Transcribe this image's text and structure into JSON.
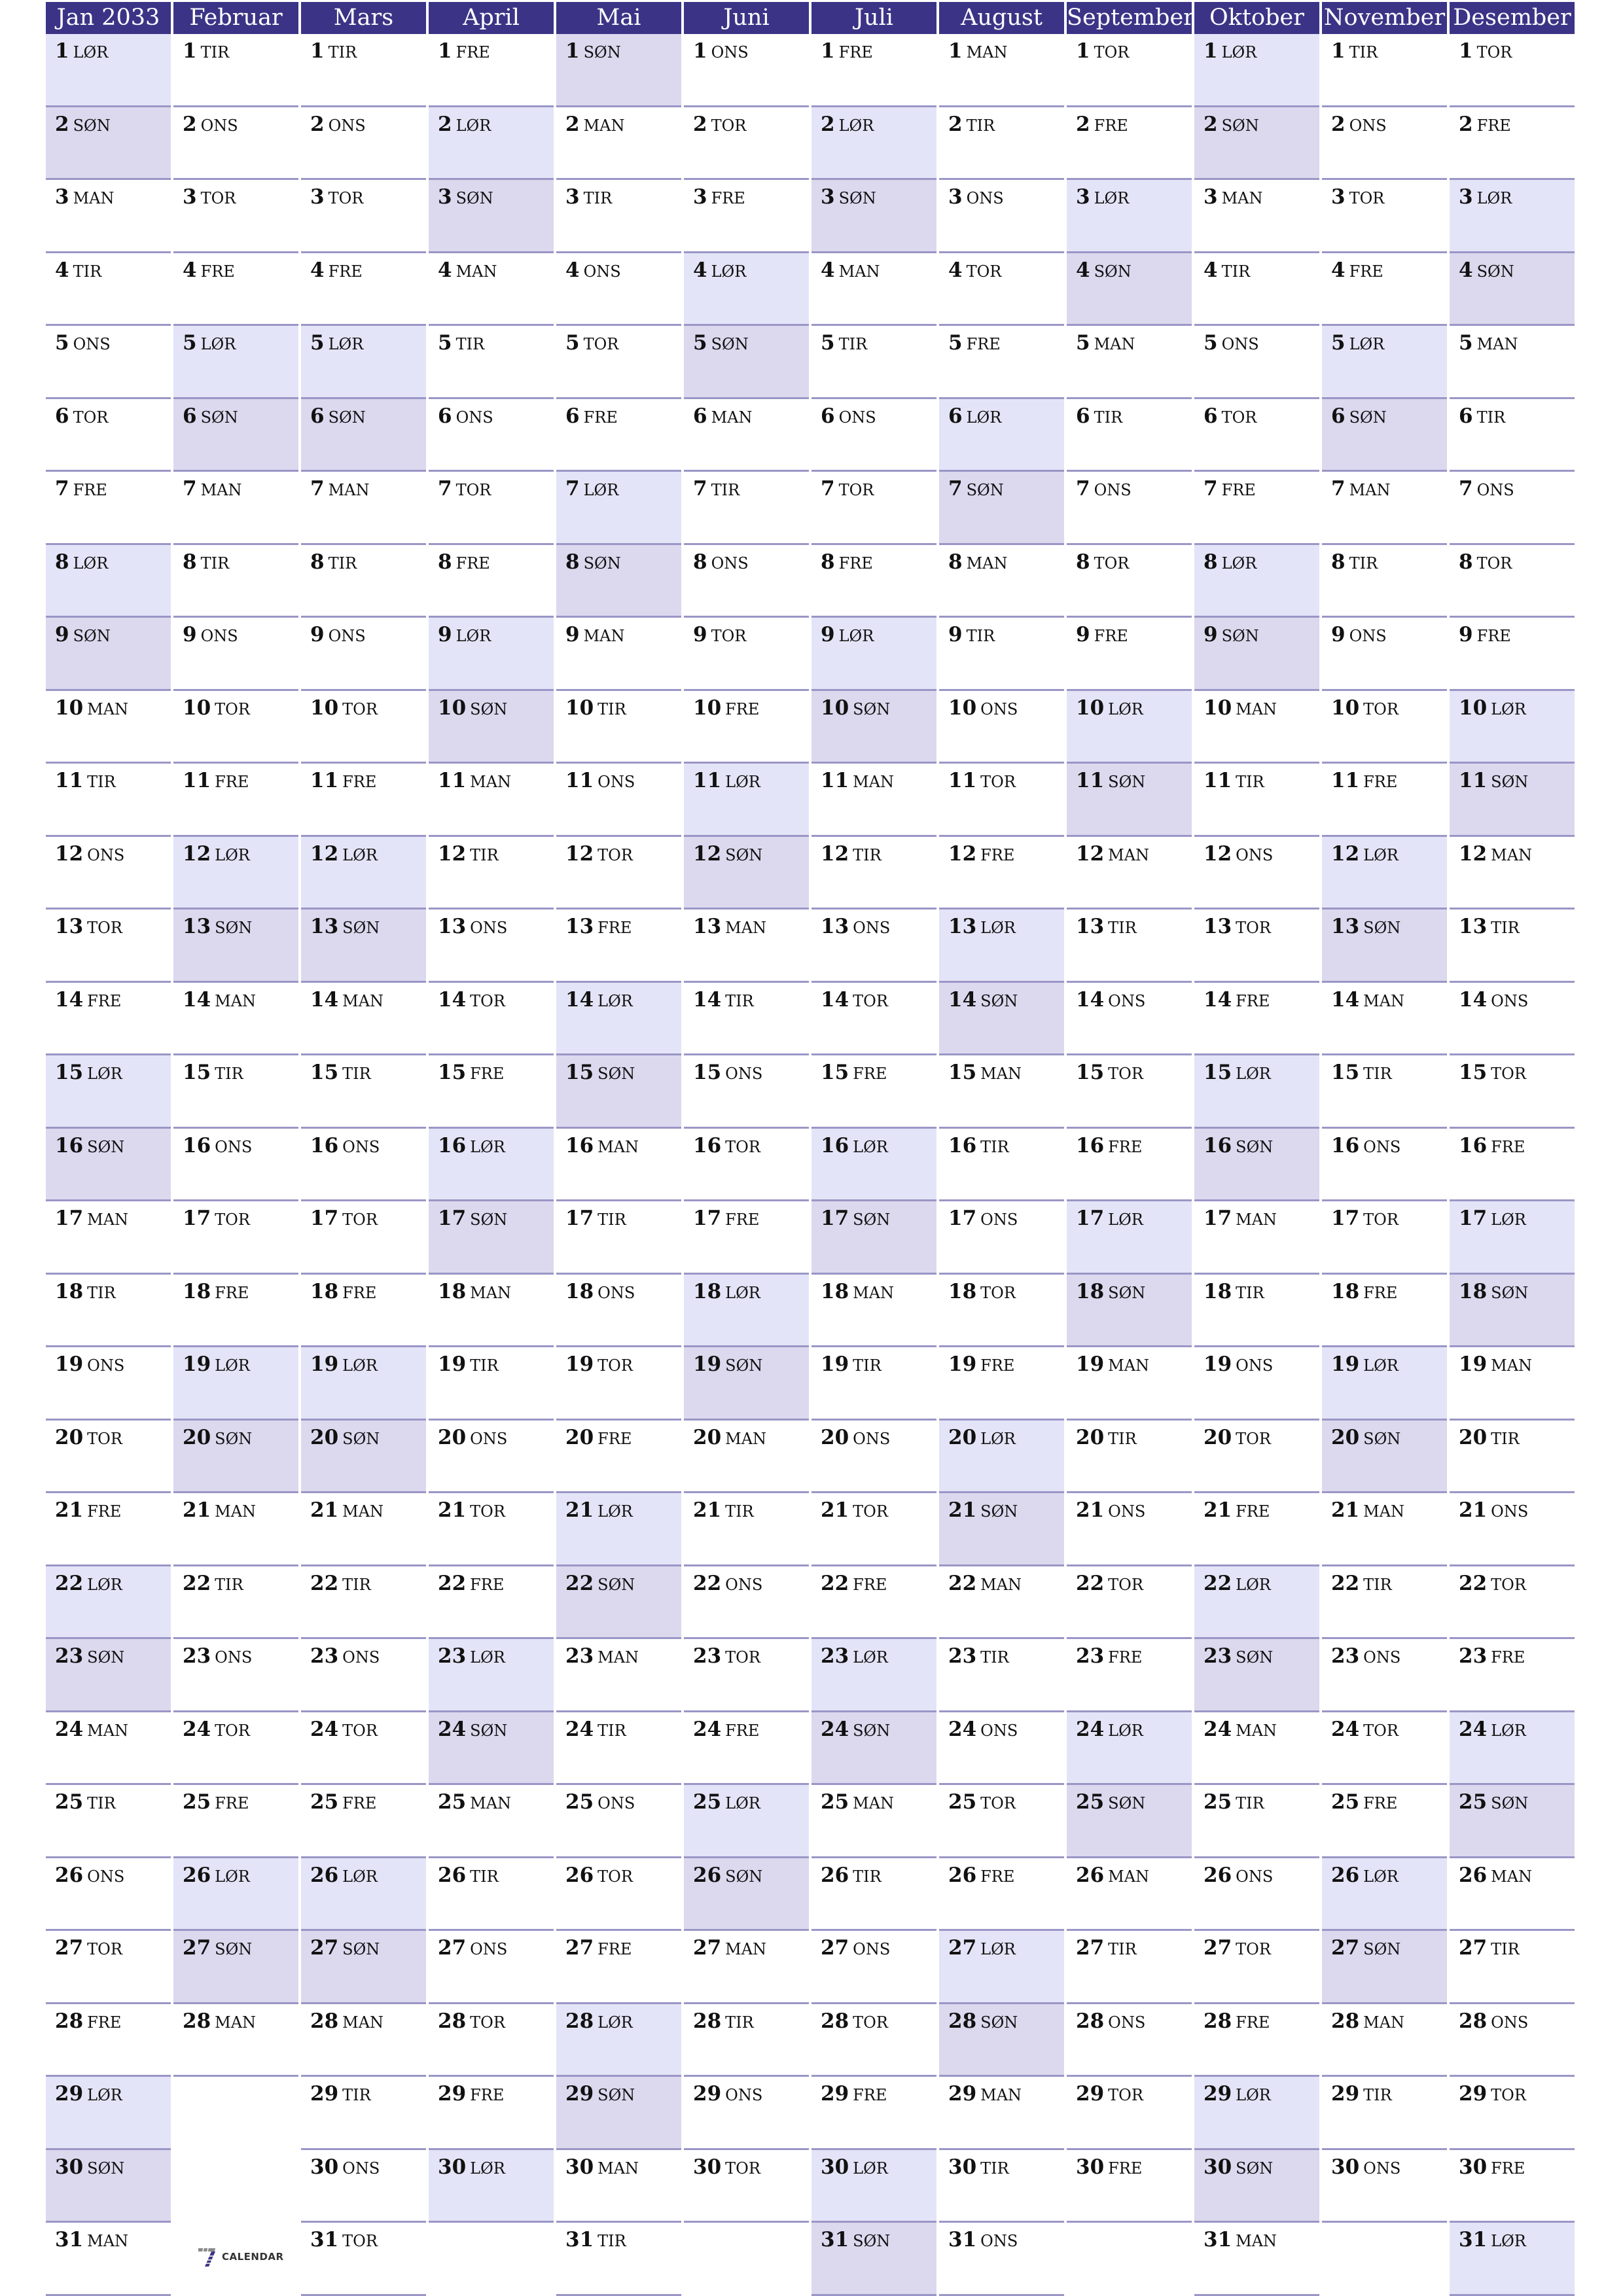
{
  "year": "2033",
  "colors": {
    "header": "#3b3486",
    "saturday": "#e4e4f8",
    "sunday": "#dcd8ee",
    "grid_line": "#9a96c6"
  },
  "logo": {
    "text": "CALENDAR",
    "icon": "seven-calendar-logo-icon"
  },
  "weekend_labels": {
    "saturday": "LØR",
    "sunday": "SØN"
  },
  "months": [
    {
      "name": "Jan 2033",
      "days": [
        "LØR",
        "SØN",
        "MAN",
        "TIR",
        "ONS",
        "TOR",
        "FRE",
        "LØR",
        "SØN",
        "MAN",
        "TIR",
        "ONS",
        "TOR",
        "FRE",
        "LØR",
        "SØN",
        "MAN",
        "TIR",
        "ONS",
        "TOR",
        "FRE",
        "LØR",
        "SØN",
        "MAN",
        "TIR",
        "ONS",
        "TOR",
        "FRE",
        "LØR",
        "SØN",
        "MAN"
      ]
    },
    {
      "name": "Februar",
      "days": [
        "TIR",
        "ONS",
        "TOR",
        "FRE",
        "LØR",
        "SØN",
        "MAN",
        "TIR",
        "ONS",
        "TOR",
        "FRE",
        "LØR",
        "SØN",
        "MAN",
        "TIR",
        "ONS",
        "TOR",
        "FRE",
        "LØR",
        "SØN",
        "MAN",
        "TIR",
        "ONS",
        "TOR",
        "FRE",
        "LØR",
        "SØN",
        "MAN"
      ]
    },
    {
      "name": "Mars",
      "days": [
        "TIR",
        "ONS",
        "TOR",
        "FRE",
        "LØR",
        "SØN",
        "MAN",
        "TIR",
        "ONS",
        "TOR",
        "FRE",
        "LØR",
        "SØN",
        "MAN",
        "TIR",
        "ONS",
        "TOR",
        "FRE",
        "LØR",
        "SØN",
        "MAN",
        "TIR",
        "ONS",
        "TOR",
        "FRE",
        "LØR",
        "SØN",
        "MAN",
        "TIR",
        "ONS",
        "TOR"
      ]
    },
    {
      "name": "April",
      "days": [
        "FRE",
        "LØR",
        "SØN",
        "MAN",
        "TIR",
        "ONS",
        "TOR",
        "FRE",
        "LØR",
        "SØN",
        "MAN",
        "TIR",
        "ONS",
        "TOR",
        "FRE",
        "LØR",
        "SØN",
        "MAN",
        "TIR",
        "ONS",
        "TOR",
        "FRE",
        "LØR",
        "SØN",
        "MAN",
        "TIR",
        "ONS",
        "TOR",
        "FRE",
        "LØR"
      ]
    },
    {
      "name": "Mai",
      "days": [
        "SØN",
        "MAN",
        "TIR",
        "ONS",
        "TOR",
        "FRE",
        "LØR",
        "SØN",
        "MAN",
        "TIR",
        "ONS",
        "TOR",
        "FRE",
        "LØR",
        "SØN",
        "MAN",
        "TIR",
        "ONS",
        "TOR",
        "FRE",
        "LØR",
        "SØN",
        "MAN",
        "TIR",
        "ONS",
        "TOR",
        "FRE",
        "LØR",
        "SØN",
        "MAN",
        "TIR"
      ]
    },
    {
      "name": "Juni",
      "days": [
        "ONS",
        "TOR",
        "FRE",
        "LØR",
        "SØN",
        "MAN",
        "TIR",
        "ONS",
        "TOR",
        "FRE",
        "LØR",
        "SØN",
        "MAN",
        "TIR",
        "ONS",
        "TOR",
        "FRE",
        "LØR",
        "SØN",
        "MAN",
        "TIR",
        "ONS",
        "TOR",
        "FRE",
        "LØR",
        "SØN",
        "MAN",
        "TIR",
        "ONS",
        "TOR"
      ]
    },
    {
      "name": "Juli",
      "days": [
        "FRE",
        "LØR",
        "SØN",
        "MAN",
        "TIR",
        "ONS",
        "TOR",
        "FRE",
        "LØR",
        "SØN",
        "MAN",
        "TIR",
        "ONS",
        "TOR",
        "FRE",
        "LØR",
        "SØN",
        "MAN",
        "TIR",
        "ONS",
        "TOR",
        "FRE",
        "LØR",
        "SØN",
        "MAN",
        "TIR",
        "ONS",
        "TOR",
        "FRE",
        "LØR",
        "SØN"
      ]
    },
    {
      "name": "August",
      "days": [
        "MAN",
        "TIR",
        "ONS",
        "TOR",
        "FRE",
        "LØR",
        "SØN",
        "MAN",
        "TIR",
        "ONS",
        "TOR",
        "FRE",
        "LØR",
        "SØN",
        "MAN",
        "TIR",
        "ONS",
        "TOR",
        "FRE",
        "LØR",
        "SØN",
        "MAN",
        "TIR",
        "ONS",
        "TOR",
        "FRE",
        "LØR",
        "SØN",
        "MAN",
        "TIR",
        "ONS"
      ]
    },
    {
      "name": "September",
      "days": [
        "TOR",
        "FRE",
        "LØR",
        "SØN",
        "MAN",
        "TIR",
        "ONS",
        "TOR",
        "FRE",
        "LØR",
        "SØN",
        "MAN",
        "TIR",
        "ONS",
        "TOR",
        "FRE",
        "LØR",
        "SØN",
        "MAN",
        "TIR",
        "ONS",
        "TOR",
        "FRE",
        "LØR",
        "SØN",
        "MAN",
        "TIR",
        "ONS",
        "TOR",
        "FRE"
      ]
    },
    {
      "name": "Oktober",
      "days": [
        "LØR",
        "SØN",
        "MAN",
        "TIR",
        "ONS",
        "TOR",
        "FRE",
        "LØR",
        "SØN",
        "MAN",
        "TIR",
        "ONS",
        "TOR",
        "FRE",
        "LØR",
        "SØN",
        "MAN",
        "TIR",
        "ONS",
        "TOR",
        "FRE",
        "LØR",
        "SØN",
        "MAN",
        "TIR",
        "ONS",
        "TOR",
        "FRE",
        "LØR",
        "SØN",
        "MAN"
      ]
    },
    {
      "name": "November",
      "days": [
        "TIR",
        "ONS",
        "TOR",
        "FRE",
        "LØR",
        "SØN",
        "MAN",
        "TIR",
        "ONS",
        "TOR",
        "FRE",
        "LØR",
        "SØN",
        "MAN",
        "TIR",
        "ONS",
        "TOR",
        "FRE",
        "LØR",
        "SØN",
        "MAN",
        "TIR",
        "ONS",
        "TOR",
        "FRE",
        "LØR",
        "SØN",
        "MAN",
        "TIR",
        "ONS"
      ]
    },
    {
      "name": "Desember",
      "days": [
        "TOR",
        "FRE",
        "LØR",
        "SØN",
        "MAN",
        "TIR",
        "ONS",
        "TOR",
        "FRE",
        "LØR",
        "SØN",
        "MAN",
        "TIR",
        "ONS",
        "TOR",
        "FRE",
        "LØR",
        "SØN",
        "MAN",
        "TIR",
        "ONS",
        "TOR",
        "FRE",
        "LØR",
        "SØN",
        "MAN",
        "TIR",
        "ONS",
        "TOR",
        "FRE",
        "LØR"
      ]
    }
  ]
}
